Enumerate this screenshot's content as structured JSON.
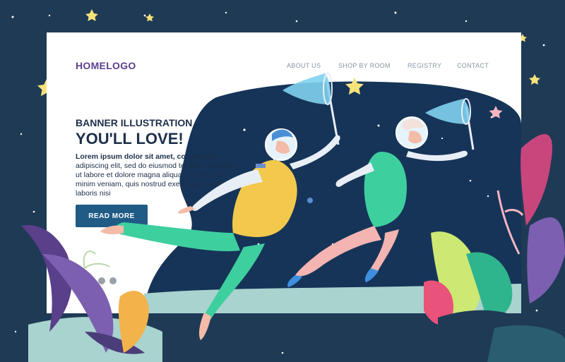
{
  "header": {
    "logo": "HOMELOGO",
    "nav": [
      {
        "label": "ABOUT US"
      },
      {
        "label": "SHOP BY ROOM"
      },
      {
        "label": "REGISTRY"
      },
      {
        "label": "CONTACT"
      }
    ]
  },
  "hero": {
    "title_line1": "BANNER ILLUSTRATION",
    "title_line2": "YOU'LL LOVE!",
    "body_bold": "Lorem ipsum dolor sit amet, consectetur",
    "body": "adipiscing elit, sed do eiusmod tempor incididunt ut labore et dolore magna aliqua. Ut enim ad minim veniam, quis nostrud exercitation ullamco laboris nisi",
    "cta_label": "READ MORE"
  },
  "slider": {
    "count": 4,
    "active_index": 0
  },
  "colors": {
    "background": "#1f3a55",
    "space": "#163458",
    "accent_button": "#1f5b84",
    "logo": "#5b3f8f",
    "floor": "#a9d3cf"
  },
  "icons": [
    "star-icon",
    "butterfly-net-icon",
    "plant-icon"
  ]
}
